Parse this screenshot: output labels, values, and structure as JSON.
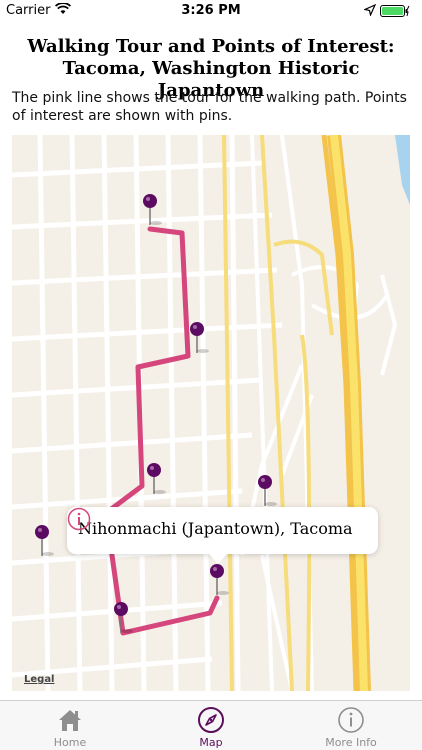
{
  "status_bar": {
    "carrier": "Carrier",
    "time": "3:26 PM"
  },
  "header": {
    "title": "Walking Tour and Points of Interest: Tacoma, Washington Historic Japantown",
    "description": "The pink line shows the tour for the walking path. Points of interest are shown with pins."
  },
  "map": {
    "legal_label": "Legal",
    "route_color": "#d4467c",
    "pin_color": "#5c0b62",
    "callout": {
      "title": "Nihonmachi (Japantown), Tacoma",
      "info_icon": "info-icon"
    }
  },
  "tab_bar": {
    "tabs": [
      {
        "label": "Home",
        "icon": "home-icon",
        "active": false
      },
      {
        "label": "Map",
        "icon": "compass-icon",
        "active": true
      },
      {
        "label": "More Info",
        "icon": "info-icon",
        "active": false
      }
    ],
    "active_color": "#5b0f5b"
  }
}
